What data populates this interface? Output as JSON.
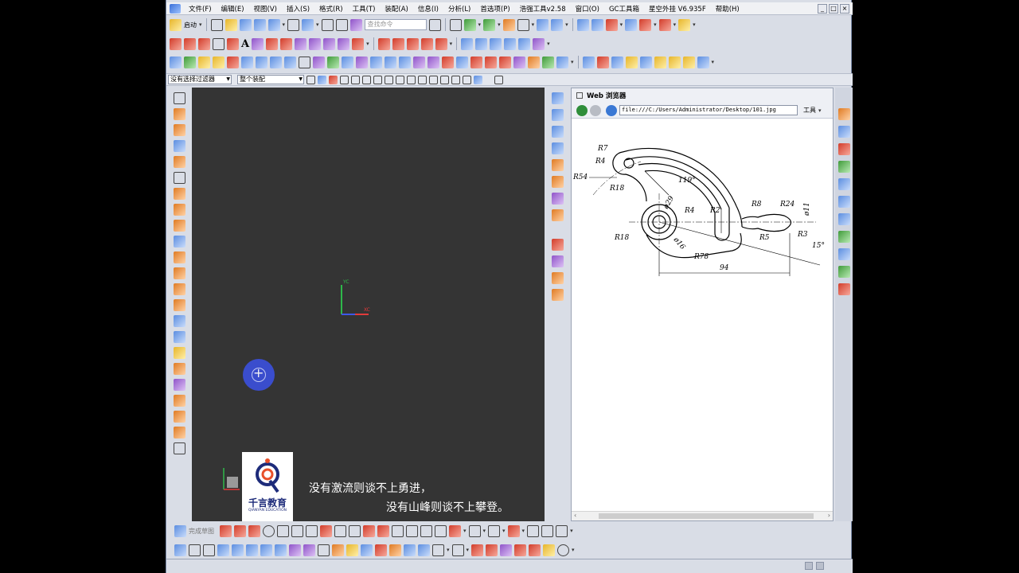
{
  "menu": [
    "文件(F)",
    "编辑(E)",
    "视图(V)",
    "插入(S)",
    "格式(R)",
    "工具(T)",
    "装配(A)",
    "信息(I)",
    "分析(L)",
    "首选项(P)",
    "浩强工具v2.58",
    "窗口(O)",
    "GC工具箱",
    "星空外挂 V6.935F",
    "帮助(H)"
  ],
  "toolbar": {
    "start_label": "启动",
    "search_placeholder": "查找命令"
  },
  "filter": {
    "selection_filter": "没有选择过滤器",
    "assembly_scope": "整个装配"
  },
  "viewport": {
    "axis_yc": "YC",
    "axis_xc": "XC"
  },
  "watermark": {
    "logo_cn": "千言教育",
    "logo_en": "QIANYAN EDUCATION",
    "slogan_line1": "没有激流则谈不上勇进，",
    "slogan_line2": "没有山峰则谈不上攀登。"
  },
  "web": {
    "title": "Web 浏览器",
    "url": "file:///C:/Users/Administrator/Desktop/101.jpg",
    "tools_label": "工具"
  },
  "drawing_dims": [
    "R7",
    "R4",
    "R54",
    "R18",
    "119°",
    "ø29",
    "R4",
    "R2",
    "R8",
    "R24",
    "ø11",
    "R18",
    "ø16",
    "R5",
    "R3",
    "15°",
    "R78",
    "94"
  ],
  "bottom": {
    "sketch_label": "完成草图"
  },
  "colors": {
    "viewport_bg": "#343434",
    "cursor": "#3b4fd6",
    "ui_bg": "#d9dde6"
  }
}
